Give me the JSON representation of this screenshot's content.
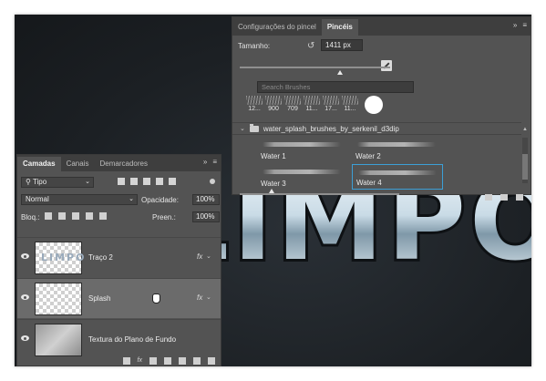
{
  "brushes_panel": {
    "tabs": [
      "Configurações do pincel",
      "Pincéis"
    ],
    "active_tab": "Pincéis",
    "size_label": "Tamanho:",
    "size_value": "1411 px",
    "search_placeholder": "Search Brushes",
    "presets": [
      "12...",
      "900",
      "709",
      "11...",
      "17...",
      "11..."
    ],
    "folder_name": "water_splash_brushes_by_serkenil_d3dip",
    "brushes": [
      "Water 1",
      "Water 2",
      "Water 3",
      "Water 4"
    ],
    "selected_brush": "Water 4",
    "accent_color": "#3c9fd6"
  },
  "layers_panel": {
    "tabs": [
      "Camadas",
      "Canais",
      "Demarcadores"
    ],
    "active_tab": "Camadas",
    "filter_kind": "Tipo",
    "blend_mode": "Normal",
    "opacity_label": "Opacidade:",
    "opacity_value": "100%",
    "lock_label": "Bloq.:",
    "fill_label": "Preen.:",
    "fill_value": "100%",
    "layers": [
      {
        "name": "Traço 2",
        "has_fx": true,
        "thumb_text": "LIMPO"
      },
      {
        "name": "Splash",
        "has_fx": true
      },
      {
        "name": "Textura do Plano de Fundo",
        "has_fx": false
      }
    ],
    "fx_label": "fx",
    "selected_layer": "Splash"
  },
  "canvas": {
    "artwork_text": "LIMPO"
  }
}
